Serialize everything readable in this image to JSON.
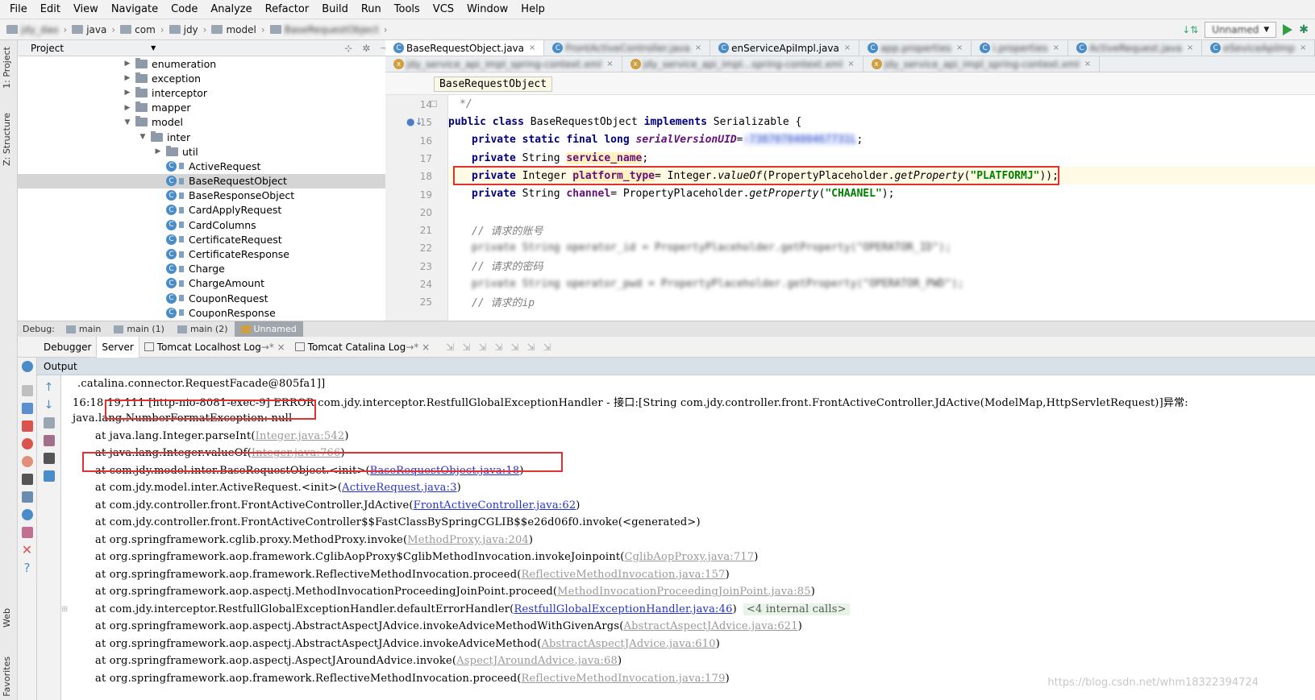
{
  "menu": [
    "File",
    "Edit",
    "View",
    "Navigate",
    "Code",
    "Analyze",
    "Refactor",
    "Build",
    "Run",
    "Tools",
    "VCS",
    "Window",
    "Help"
  ],
  "navbar": {
    "crumbs": [
      "jdy_dao",
      "java",
      "com",
      "jdy",
      "model",
      "BaseRequestObject"
    ],
    "config": "Unnamed"
  },
  "sidebar_tabs": [
    "1: Project",
    "Z: Structure",
    "Web",
    "Favorites"
  ],
  "project": {
    "title": "Project",
    "tree": [
      {
        "label": "enumeration",
        "type": "folder",
        "depth": 0,
        "expanded": false
      },
      {
        "label": "exception",
        "type": "folder",
        "depth": 0,
        "expanded": false
      },
      {
        "label": "interceptor",
        "type": "folder",
        "depth": 0,
        "expanded": false
      },
      {
        "label": "mapper",
        "type": "folder",
        "depth": 0,
        "expanded": false
      },
      {
        "label": "model",
        "type": "folder",
        "depth": 0,
        "expanded": true
      },
      {
        "label": "inter",
        "type": "folder",
        "depth": 1,
        "expanded": true
      },
      {
        "label": "util",
        "type": "folder",
        "depth": 2,
        "expanded": false
      },
      {
        "label": "ActiveRequest",
        "type": "class",
        "depth": 3
      },
      {
        "label": "BaseRequestObject",
        "type": "class",
        "depth": 3,
        "selected": true
      },
      {
        "label": "BaseResponseObject",
        "type": "class",
        "depth": 3
      },
      {
        "label": "CardApplyRequest",
        "type": "class",
        "depth": 3
      },
      {
        "label": "CardColumns",
        "type": "class",
        "depth": 3
      },
      {
        "label": "CertificateRequest",
        "type": "class",
        "depth": 3
      },
      {
        "label": "CertificateResponse",
        "type": "class",
        "depth": 3
      },
      {
        "label": "Charge",
        "type": "class",
        "depth": 3
      },
      {
        "label": "ChargeAmount",
        "type": "class",
        "depth": 3
      },
      {
        "label": "CouponRequest",
        "type": "class",
        "depth": 3
      },
      {
        "label": "CouponResponse",
        "type": "class",
        "depth": 3
      }
    ]
  },
  "editor": {
    "tabs_row1": [
      "BaseRequestObject.java",
      "FrontActiveController.java",
      "enServiceApiImpl.java",
      "app.properties",
      "i.properties",
      "ActiveRequest.java",
      "eSeviceApiImp"
    ],
    "tabs_row2": [
      "jdy_service_api_impl_spring-context.xml",
      "jdy_service_api_impl...spring-context.xml",
      "jdy_service_api_impl_spring-context.xml"
    ],
    "class_crumb": "BaseRequestObject",
    "line_numbers": [
      "14",
      "15",
      "16",
      "17",
      "18",
      "19",
      "20",
      "21",
      "22",
      "23",
      "24",
      "25"
    ],
    "lines": {
      "l14": "*/",
      "l15_kw": "public class",
      "l15_name": "BaseRequestObject",
      "l15_impl": "implements",
      "l15_rest": "Serializable {",
      "l16_kw": "private static final long",
      "l16_field": "serialVersionUID",
      "l16_eq": " = ",
      "l16_val": "-7387078400467731L",
      "l16_end": ";",
      "l17_kw": "private",
      "l17_type": "String",
      "l17_field": "service_name",
      "l17_end": ";",
      "l18_kw": "private",
      "l18_type": "Integer",
      "l18_field": "platform_type",
      "l18_mid": " = Integer.",
      "l18_call": "valueOf",
      "l18_mid2": "(PropertyPlaceholder.",
      "l18_call2": "getProperty",
      "l18_open": "(",
      "l18_str": "\"PLATFORMJ\"",
      "l18_end": "));",
      "l19_kw": "private",
      "l19_type": "String",
      "l19_field": "channel",
      "l19_mid": " = PropertyPlaceholder.",
      "l19_call": "getProperty",
      "l19_open": "(",
      "l19_str": "\"CHAANEL\"",
      "l19_end": ");",
      "l21": "// 请求的账号",
      "l22": "private String operator_id = PropertyPlaceholder.getProperty(\"OPERATOR_ID\");",
      "l23": "// 请求的密码",
      "l24": "private String operator_pwd = PropertyPlaceholder.getProperty(\"OPERATOR_PWD\");",
      "l25": "// 请求的ip"
    }
  },
  "debug": {
    "label": "Debug:",
    "sessions": [
      "main",
      "main (1)",
      "main (2)",
      "Unnamed"
    ],
    "tabs": [
      "Debugger",
      "Server",
      "Tomcat Localhost Log",
      "Tomcat Catalina Log"
    ],
    "output_title": "Output"
  },
  "console": [
    {
      "indent": 0,
      "text": ".catalina.connector.RequestFacade@805fa1]]"
    },
    {
      "indent": -1,
      "text": "16:18:19,111 [http-nio-8081-exec-9] ERROR com.jdy.interceptor.RestfullGlobalExceptionHandler -   接口:[String com.jdy.controller.front.FrontActiveController.JdActive(ModelMap,HttpServletRequest)]异常:"
    },
    {
      "indent": -1,
      "text": "java.lang.NumberFormatException: null"
    },
    {
      "indent": 1,
      "text": "at java.lang.Integer.parseInt(",
      "link": "Integer.java:542",
      "close": ")",
      "lt": "g"
    },
    {
      "indent": 1,
      "text": "at java.lang.Integer.valueOf(",
      "link": "Integer.java:766",
      "close": ")",
      "lt": "g"
    },
    {
      "indent": 1,
      "text": "at com.jdy.model.inter.BaseRequestObject.<init>(",
      "link": "BaseRequestObject.java:18",
      "close": ")",
      "lt": "b"
    },
    {
      "indent": 1,
      "text": "at com.jdy.model.inter.ActiveRequest.<init>(",
      "link": "ActiveRequest.java:3",
      "close": ")",
      "lt": "b"
    },
    {
      "indent": 1,
      "text": "at com.jdy.controller.front.FrontActiveController.JdActive(",
      "link": "FrontActiveController.java:62",
      "close": ")",
      "lt": "b"
    },
    {
      "indent": 1,
      "text": "at com.jdy.controller.front.FrontActiveController$$FastClassBySpringCGLIB$$e26d06f0.invoke(<generated>)"
    },
    {
      "indent": 1,
      "text": "at org.springframework.cglib.proxy.MethodProxy.invoke(",
      "link": "MethodProxy.java:204",
      "close": ")",
      "lt": "g"
    },
    {
      "indent": 1,
      "text": "at org.springframework.aop.framework.CglibAopProxy$CglibMethodInvocation.invokeJoinpoint(",
      "link": "CglibAopProxy.java:717",
      "close": ")",
      "lt": "g"
    },
    {
      "indent": 1,
      "text": "at org.springframework.aop.framework.ReflectiveMethodInvocation.proceed(",
      "link": "ReflectiveMethodInvocation.java:157",
      "close": ")",
      "lt": "g"
    },
    {
      "indent": 1,
      "text": "at org.springframework.aop.aspectj.MethodInvocationProceedingJoinPoint.proceed(",
      "link": "MethodInvocationProceedingJoinPoint.java:85",
      "close": ")",
      "lt": "g"
    },
    {
      "indent": 1,
      "text": "at com.jdy.interceptor.RestfullGlobalExceptionHandler.defaultErrorHandler(",
      "link": "RestfullGlobalExceptionHandler.java:46",
      "close": ")",
      "lt": "b",
      "extra": "<4 internal calls>",
      "plus": true
    },
    {
      "indent": 1,
      "text": "at org.springframework.aop.aspectj.AbstractAspectJAdvice.invokeAdviceMethodWithGivenArgs(",
      "link": "AbstractAspectJAdvice.java:621",
      "close": ")",
      "lt": "g"
    },
    {
      "indent": 1,
      "text": "at org.springframework.aop.aspectj.AbstractAspectJAdvice.invokeAdviceMethod(",
      "link": "AbstractAspectJAdvice.java:610",
      "close": ")",
      "lt": "g"
    },
    {
      "indent": 1,
      "text": "at org.springframework.aop.aspectj.AspectJAroundAdvice.invoke(",
      "link": "AspectJAroundAdvice.java:68",
      "close": ")",
      "lt": "g"
    },
    {
      "indent": 1,
      "text": "at org.springframework.aop.framework.ReflectiveMethodInvocation.proceed(",
      "link": "ReflectiveMethodInvocation.java:179",
      "close": ")",
      "lt": "g"
    }
  ],
  "watermark": "https://blog.csdn.net/whm18322394724",
  "colors": {
    "highlight_box": "#e03030",
    "link_blue": "#2233cc",
    "keyword": "#000080",
    "string": "#008000",
    "field": "#660e7a"
  }
}
